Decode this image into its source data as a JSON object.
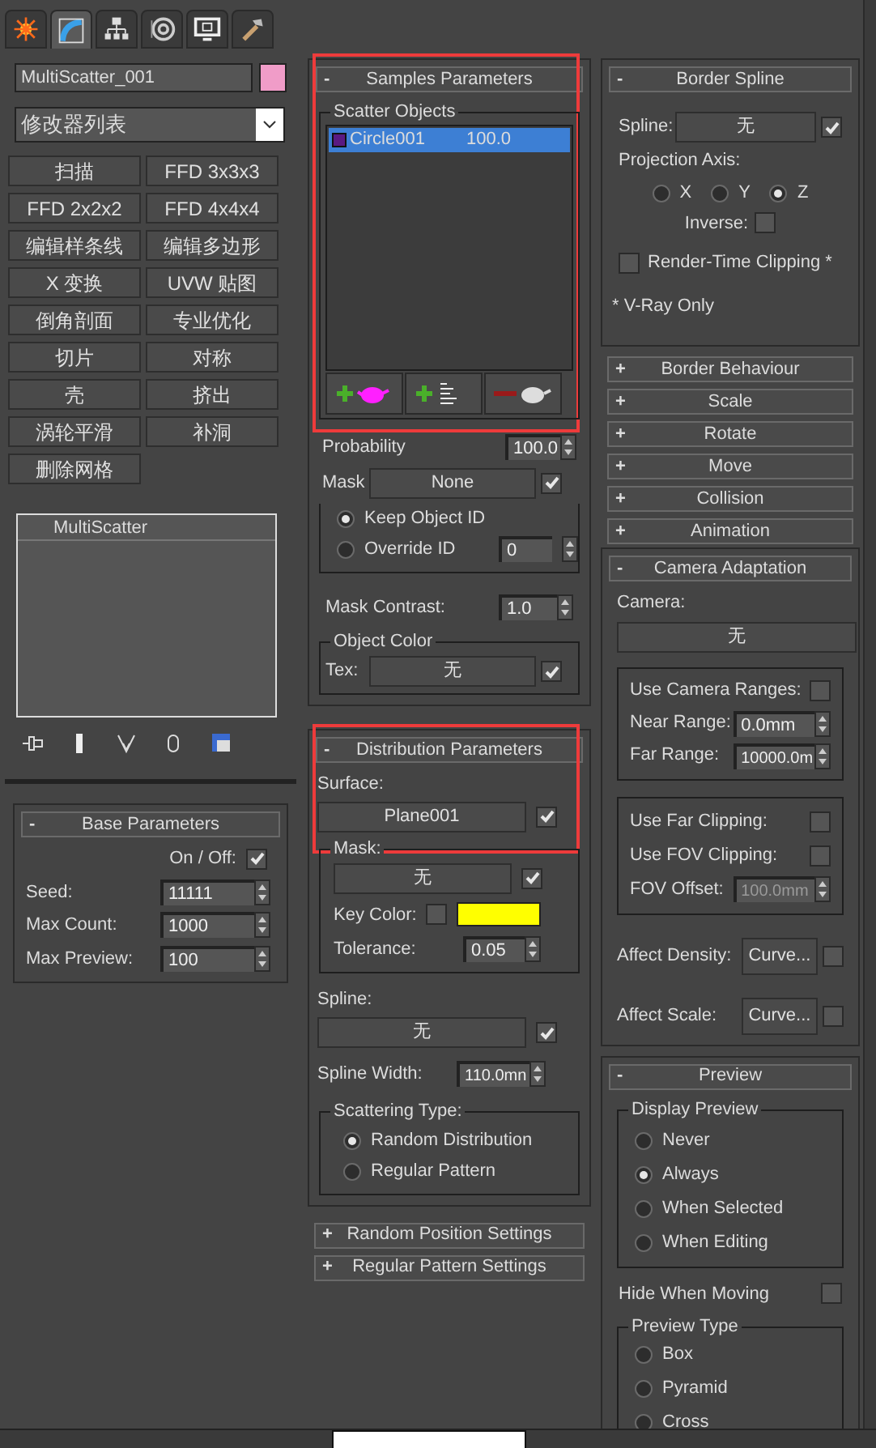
{
  "command_tabs": [
    {
      "selected": false
    },
    {
      "selected": true
    },
    {
      "selected": false
    },
    {
      "selected": false
    },
    {
      "selected": false
    },
    {
      "selected": false
    }
  ],
  "object": {
    "name": "MultiScatter_001",
    "color": "#f09cc8"
  },
  "modifier_list": "修改器列表",
  "modifier_buttons": [
    "扫描",
    "FFD 3x3x3",
    "FFD 2x2x2",
    "FFD 4x4x4",
    "编辑样条线",
    "编辑多边形",
    "X 变换",
    "UVW 贴图",
    "倒角剖面",
    "专业优化",
    "切片",
    "对称",
    "壳",
    "挤出",
    "涡轮平滑",
    "补洞",
    "删除网格"
  ],
  "modifier_stack": [
    {
      "label": "MultiScatter",
      "selected": false
    }
  ],
  "base_parameters": {
    "toggle": "-",
    "title": "Base Parameters",
    "on_off": {
      "label": "On / Off:",
      "checked": true
    },
    "fields": [
      {
        "label": "Seed:",
        "value": "11111"
      },
      {
        "label": "Max Count:",
        "value": "1000"
      },
      {
        "label": "Max Preview:",
        "value": "100"
      }
    ]
  },
  "samples_parameters": {
    "toggle": "-",
    "title": "Samples Parameters",
    "highlighted": true,
    "group_label": "Scatter Objects",
    "items": [
      {
        "name": "Circle001",
        "value": "100.0",
        "color": "#5a1a82",
        "selected": true
      }
    ],
    "probability": {
      "label": "Probability",
      "value": "100.0"
    },
    "mask": {
      "label": "Mask",
      "value": "None",
      "checked": true
    },
    "id_options": [
      {
        "label": "Keep Object ID",
        "selected": true
      },
      {
        "label": "Override ID",
        "selected": false
      }
    ],
    "override_id": "0",
    "mask_contrast": {
      "label": "Mask Contrast:",
      "value": "1.0"
    },
    "object_color": {
      "group_label": "Object Color",
      "label": "Tex:",
      "value": "无",
      "checked": true
    }
  },
  "distribution_parameters": {
    "toggle": "-",
    "title": "Distribution Parameters",
    "highlighted": true,
    "surface": {
      "label": "Surface:",
      "value": "Plane001",
      "checked": true
    },
    "mask": {
      "group_label": "Mask:",
      "value": "无",
      "checked": true,
      "key_color": {
        "label": "Key Color:",
        "checked": false,
        "color": "#ffff00"
      },
      "tolerance_label": "Tolerance:",
      "tolerance": "0.05"
    },
    "spline": {
      "label": "Spline:",
      "value": "无",
      "checked": true
    },
    "spline_width": {
      "label": "Spline Width:",
      "value": "110.0mn"
    },
    "scattering_type": {
      "group_label": "Scattering Type:",
      "options": [
        {
          "label": "Random Distribution",
          "selected": true
        },
        {
          "label": "Regular Pattern",
          "selected": false
        }
      ]
    }
  },
  "middle_collapsed": [
    {
      "toggle": "+",
      "title": "Random Position Settings"
    },
    {
      "toggle": "+",
      "title": "Regular Pattern Settings"
    }
  ],
  "border_spline": {
    "toggle": "-",
    "title": "Border Spline",
    "spline": {
      "label": "Spline:",
      "value": "无",
      "checked": true
    },
    "projection_axis": {
      "label": "Projection Axis:",
      "options": [
        {
          "label": "X",
          "selected": false
        },
        {
          "label": "Y",
          "selected": false
        },
        {
          "label": "Z",
          "selected": true
        }
      ]
    },
    "inverse": {
      "label": "Inverse:",
      "checked": false
    },
    "render_time_clipping": {
      "label": "Render-Time Clipping *",
      "checked": false
    },
    "note": "* V-Ray Only"
  },
  "right_collapsed": [
    {
      "toggle": "+",
      "title": "Border Behaviour"
    },
    {
      "toggle": "+",
      "title": "Scale"
    },
    {
      "toggle": "+",
      "title": "Rotate"
    },
    {
      "toggle": "+",
      "title": "Move"
    },
    {
      "toggle": "+",
      "title": "Collision"
    },
    {
      "toggle": "+",
      "title": "Animation"
    }
  ],
  "camera_adaptation": {
    "toggle": "-",
    "title": "Camera Adaptation",
    "camera_label": "Camera:",
    "camera_value": "无",
    "use_camera_ranges": {
      "label": "Use Camera Ranges:",
      "checked": false
    },
    "near_range": {
      "label": "Near Range:",
      "value": "0.0mm"
    },
    "far_range": {
      "label": "Far Range:",
      "value": "10000.0m"
    },
    "use_far_clipping": {
      "label": "Use Far Clipping:",
      "checked": false
    },
    "use_fov_clipping": {
      "label": "Use FOV Clipping:",
      "checked": false
    },
    "fov_offset": {
      "label": "FOV Offset:",
      "value": "100.0mm",
      "disabled": true
    },
    "affect": [
      {
        "label": "Affect Density:",
        "button": "Curve...",
        "checked": false
      },
      {
        "label": "Affect Scale:",
        "button": "Curve...",
        "checked": false
      }
    ]
  },
  "preview": {
    "toggle": "-",
    "title": "Preview",
    "display_preview": {
      "group_label": "Display Preview",
      "options": [
        {
          "label": "Never",
          "selected": false
        },
        {
          "label": "Always",
          "selected": true
        },
        {
          "label": "When Selected",
          "selected": false
        },
        {
          "label": "When Editing",
          "selected": false
        }
      ]
    },
    "hide_when_moving": {
      "label": "Hide When Moving",
      "checked": false
    },
    "preview_type": {
      "group_label": "Preview Type",
      "options": [
        {
          "label": "Box",
          "selected": false
        },
        {
          "label": "Pyramid",
          "selected": false
        },
        {
          "label": "Cross",
          "selected": false
        }
      ]
    }
  }
}
